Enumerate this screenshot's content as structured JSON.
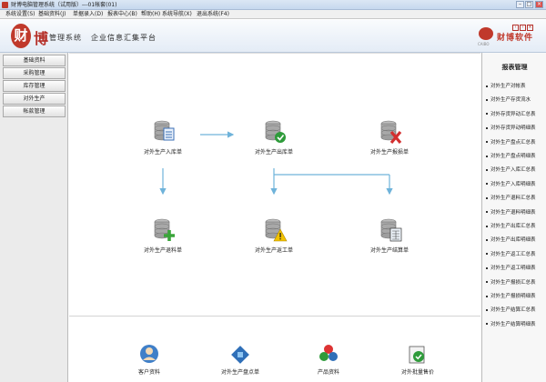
{
  "window": {
    "title": "财博电脑管理系统（试用版）---01帐套(01)",
    "min": "–",
    "max": "□",
    "close": "×"
  },
  "menu": [
    "系统设置(S)",
    "基础资料(J)",
    "单据录入(D)",
    "报表中心(B)",
    "帮助(H)",
    "系统导航(X)",
    "退出系统(F4)"
  ],
  "banner": {
    "logo_char": "财",
    "logo_char2": "博",
    "system": "管理系统",
    "slogan": "企业信息汇集平台",
    "brand_name": "财博软件",
    "brand_sub": "CAIBO"
  },
  "left_nav": [
    "基础资料",
    "采购管理",
    "库存管理",
    "对外生产",
    "帐款管理"
  ],
  "workflow": {
    "nodes": [
      {
        "name": "node-inbound-order",
        "label": "对外生产入库单"
      },
      {
        "name": "node-outbound-order",
        "label": "对外生产出库单"
      },
      {
        "name": "node-scrap-order",
        "label": "对外生产报损单"
      },
      {
        "name": "node-supplement-order",
        "label": "对外生产退料单"
      },
      {
        "name": "node-defect-order",
        "label": "对外生产返工单"
      },
      {
        "name": "node-settlement-order",
        "label": "对外生产结算单"
      }
    ],
    "shortcuts": [
      {
        "name": "customer-info-shortcut",
        "label": "客户资料"
      },
      {
        "name": "stock-check-shortcut",
        "label": "对外生产盘点单"
      },
      {
        "name": "product-info-shortcut",
        "label": "产品资料"
      },
      {
        "name": "price-adjust-shortcut",
        "label": "对外批量售价"
      }
    ]
  },
  "reports": {
    "title": "报表管理",
    "items": [
      "对外生产对帐表",
      "对外生产存货流水",
      "对外存货异动汇总表",
      "对外存货异动明细表",
      "对外生产盘点汇总表",
      "对外生产盘点明细表",
      "对外生产入库汇总表",
      "对外生产入库明细表",
      "对外生产退料汇总表",
      "对外生产退料明细表",
      "对外生产出库汇总表",
      "对外生产出库明细表",
      "对外生产返工汇总表",
      "对外生产返工明细表",
      "对外生产报损汇总表",
      "对外生产报损明细表",
      "对外生产结算汇总表",
      "对外生产结算明细表"
    ]
  },
  "colors": {
    "arrow": "#6fb3da",
    "brand": "#c0392b",
    "db_body": "#9e9e9e",
    "check": "#2e9b3a",
    "cross": "#d32f2f",
    "plus": "#3aa53a",
    "warn": "#f2c200"
  }
}
